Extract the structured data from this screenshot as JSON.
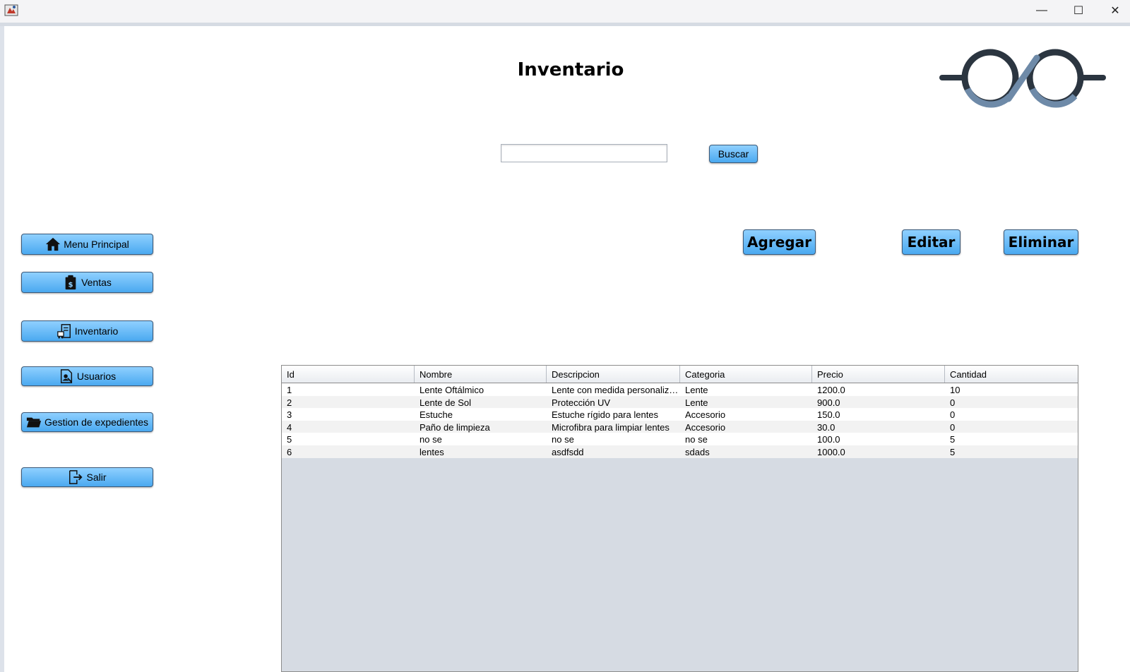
{
  "window": {
    "controls": {
      "minimize": "—",
      "maximize": "☐",
      "close": "✕"
    }
  },
  "header": {
    "title": "Inventario"
  },
  "search": {
    "value": "",
    "placeholder": "",
    "button_label": "Buscar"
  },
  "actions": {
    "add_label": "Agregar",
    "edit_label": "Editar",
    "delete_label": "Eliminar"
  },
  "sidebar": {
    "items": [
      {
        "label": "Menu Principal",
        "icon": "home-icon"
      },
      {
        "label": "Ventas",
        "icon": "sales-clipboard-icon"
      },
      {
        "label": "Inventario",
        "icon": "inventory-icon"
      },
      {
        "label": "Usuarios",
        "icon": "users-document-icon"
      },
      {
        "label": "Gestion de expedientes",
        "icon": "folder-icon"
      },
      {
        "label": "Salir",
        "icon": "exit-icon"
      }
    ]
  },
  "table": {
    "columns": [
      "Id",
      "Nombre",
      "Descripcion",
      "Categoria",
      "Precio",
      "Cantidad"
    ],
    "rows": [
      [
        "1",
        "Lente Oftálmico",
        "Lente con medida personaliza...",
        "Lente",
        "1200.0",
        "10"
      ],
      [
        "2",
        "Lente de Sol",
        "Protección UV",
        "Lente",
        "900.0",
        "0"
      ],
      [
        "3",
        "Estuche",
        "Estuche rígido para lentes",
        "Accesorio",
        "150.0",
        "0"
      ],
      [
        "4",
        "Paño de limpieza",
        "Microfibra para limpiar lentes",
        "Accesorio",
        "30.0",
        "0"
      ],
      [
        "5",
        "no se",
        "no se",
        "no se",
        "100.0",
        "5"
      ],
      [
        "6",
        "lentes",
        "asdfsdd",
        "sdads",
        "1000.0",
        "5"
      ]
    ]
  },
  "colors": {
    "button_top": "#8fd0ff",
    "button_bottom": "#4aa9f0",
    "logo_dark": "#2b3540",
    "logo_light": "#6e8aa8",
    "table_empty": "#d6dbe3"
  }
}
